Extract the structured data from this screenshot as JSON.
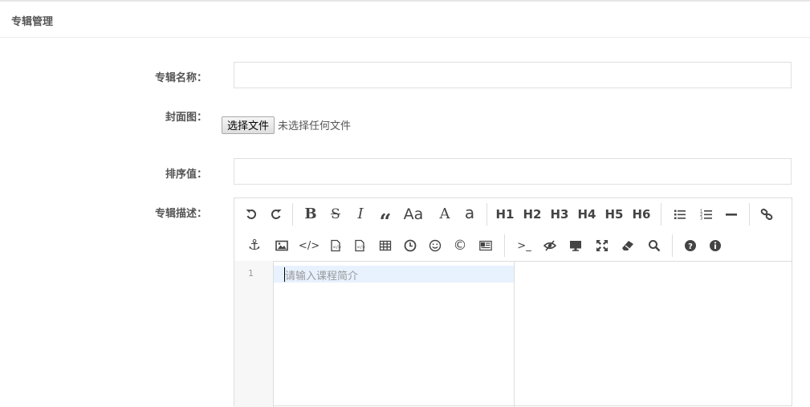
{
  "header": {
    "title": "专辑管理"
  },
  "form": {
    "name_label": "专辑名称：",
    "name_value": "",
    "cover_label": "封面图：",
    "file_button": "选择文件",
    "file_status": "未选择任何文件",
    "sort_label": "排序值：",
    "sort_value": "",
    "desc_label": "专辑描述："
  },
  "editor": {
    "toolbar_row1": [
      "undo-icon",
      "redo-icon",
      "bold-icon",
      "strikethrough-icon",
      "italic-icon",
      "quote-icon",
      "uppercase-icon",
      "uppercase-first-icon",
      "lowercase-icon",
      "h1",
      "h2",
      "h3",
      "h4",
      "h5",
      "h6",
      "unordered-list-icon",
      "ordered-list-icon",
      "horizontal-rule-icon",
      "link-icon"
    ],
    "toolbar_row2": [
      "anchor-icon",
      "image-icon",
      "inline-code-icon",
      "code-block-icon",
      "code-preformatted-icon",
      "table-icon",
      "datetime-icon",
      "emoji-icon",
      "html-entities-icon",
      "pagebreak-icon",
      "goto-line-icon",
      "watch-icon",
      "preview-icon",
      "fullscreen-icon",
      "clear-icon",
      "search-icon",
      "help-icon",
      "info-icon"
    ],
    "headings": {
      "h1": "H1",
      "h2": "H2",
      "h3": "H3",
      "h4": "H4",
      "h5": "H5",
      "h6": "H6"
    },
    "glyphs": {
      "uppercase": "Aa",
      "uppercase_first": "A",
      "lowercase": "a"
    },
    "line_number": "1",
    "placeholder": "请输入课程简介"
  }
}
